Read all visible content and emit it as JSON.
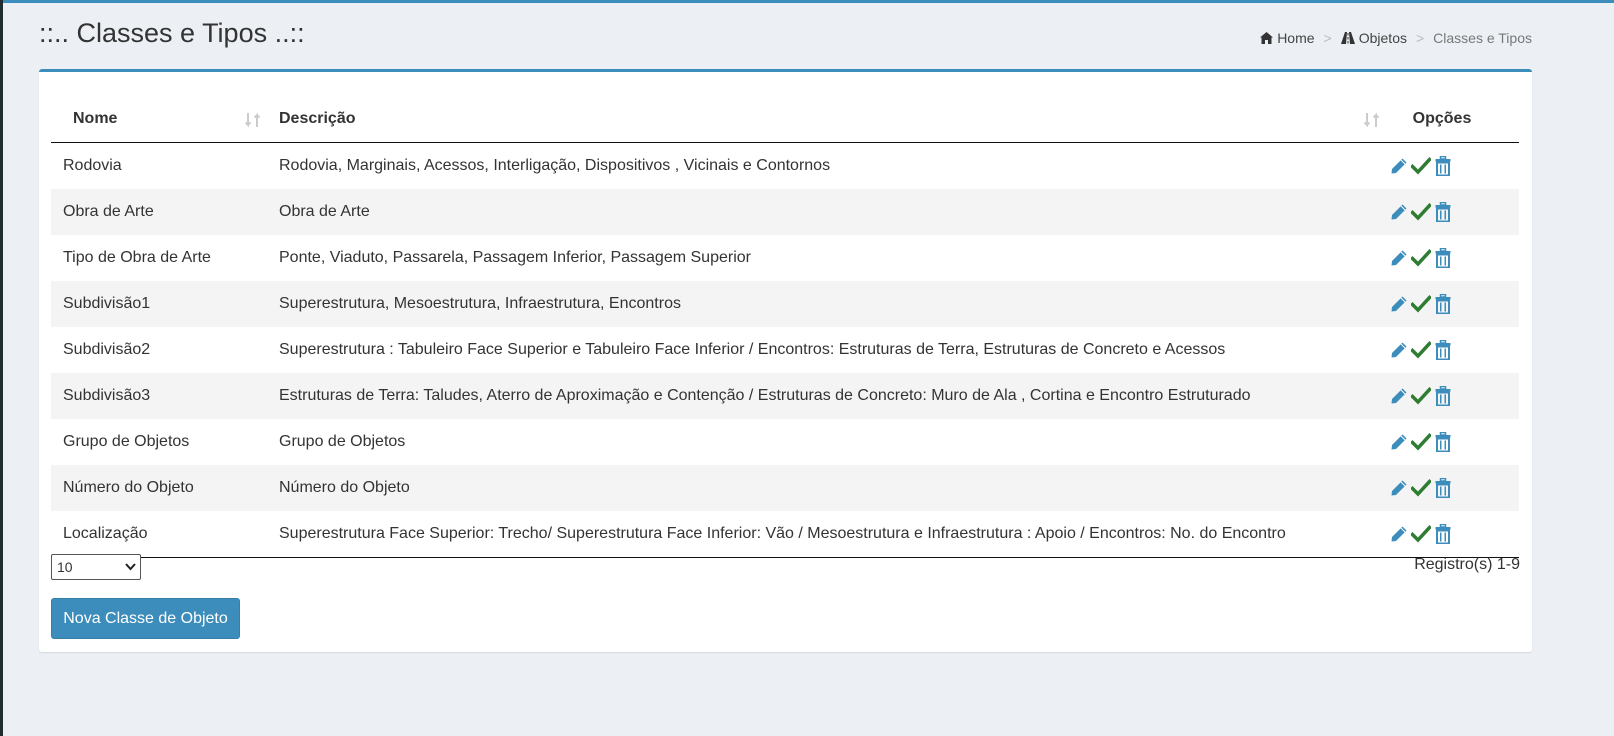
{
  "page": {
    "title": "::.. Classes e Tipos ..::",
    "breadcrumb": {
      "home": "Home",
      "objetos": "Objetos",
      "current": "Classes e Tipos",
      "separator": ">"
    }
  },
  "table": {
    "headers": {
      "nome": "Nome",
      "descricao": "Descrição",
      "opcoes": "Opções"
    },
    "rows": [
      {
        "nome": "Rodovia",
        "descricao": "Rodovia, Marginais, Acessos, Interligação, Dispositivos , Vicinais e Contornos"
      },
      {
        "nome": "Obra de Arte",
        "descricao": "Obra de Arte"
      },
      {
        "nome": "Tipo de Obra de Arte",
        "descricao": "Ponte, Viaduto, Passarela, Passagem Inferior, Passagem Superior"
      },
      {
        "nome": "Subdivisão1",
        "descricao": "Superestrutura, Mesoestrutura, Infraestrutura, Encontros"
      },
      {
        "nome": "Subdivisão2",
        "descricao": "Superestrutura : Tabuleiro Face Superior e Tabuleiro Face Inferior / Encontros: Estruturas de Terra, Estruturas de Concreto e Acessos"
      },
      {
        "nome": "Subdivisão3",
        "descricao": "Estruturas de Terra: Taludes, Aterro de Aproximação e Contenção / Estruturas de Concreto: Muro de Ala , Cortina e Encontro Estruturado"
      },
      {
        "nome": "Grupo de Objetos",
        "descricao": "Grupo de Objetos"
      },
      {
        "nome": "Número do Objeto",
        "descricao": "Número do Objeto"
      },
      {
        "nome": "Localização",
        "descricao": "Superestrutura Face Superior: Trecho/ Superestrutura Face Inferior: Vão / Mesoestrutura e Infraestrutura : Apoio / Encontros: No. do Encontro"
      }
    ],
    "row_actions": [
      "pencil-icon",
      "check-icon",
      "trash-icon"
    ]
  },
  "footer": {
    "page_size": "10",
    "records": "Registro(s) 1-9",
    "new_button": "Nova Classe de Objeto"
  },
  "colors": {
    "accent": "#3c8dbc",
    "edit_icon": "#3c8dbc",
    "check_icon": "#2e7d32",
    "trash_icon": "#3c8dbc",
    "page_bg": "#ecf0f5"
  }
}
